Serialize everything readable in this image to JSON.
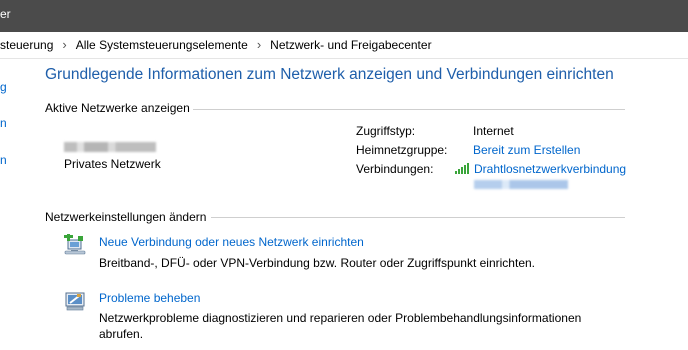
{
  "window": {
    "title": "er"
  },
  "breadcrumb": {
    "items": [
      "steuerung",
      "Alle Systemsteuerungselemente",
      "Netzwerk- und Freigabecenter"
    ]
  },
  "left_pane": {
    "links": [
      "g",
      "n",
      "n"
    ]
  },
  "main": {
    "heading": "Grundlegende Informationen zum Netzwerk anzeigen und Verbindungen einrichten",
    "active_networks": {
      "section_label": "Aktive Netzwerke anzeigen",
      "network_type": "Privates Netzwerk",
      "properties": {
        "access_type_label": "Zugriffstyp:",
        "access_type_value": "Internet",
        "homegroup_label": "Heimnetzgruppe:",
        "homegroup_value": "Bereit zum Erstellen",
        "connections_label": "Verbindungen:",
        "connections_value": "Drahtlosnetzwerkverbindung"
      }
    },
    "change_settings": {
      "section_label": "Netzwerkeinstellungen ändern",
      "tasks": [
        {
          "title": "Neue Verbindung oder neues Netzwerk einrichten",
          "description": "Breitband-, DFÜ- oder VPN-Verbindung bzw. Router oder Zugriffspunkt einrichten.",
          "icon": "new-connection-icon"
        },
        {
          "title": "Probleme beheben",
          "description": "Netzwerkprobleme diagnostizieren und reparieren oder Problembehandlungsinformationen abrufen.",
          "icon": "troubleshoot-icon"
        }
      ]
    }
  },
  "colors": {
    "titlebar": "#4b4b4b",
    "heading": "#1e5eaa",
    "link": "#0066cc",
    "signal": "#3aa53a"
  }
}
